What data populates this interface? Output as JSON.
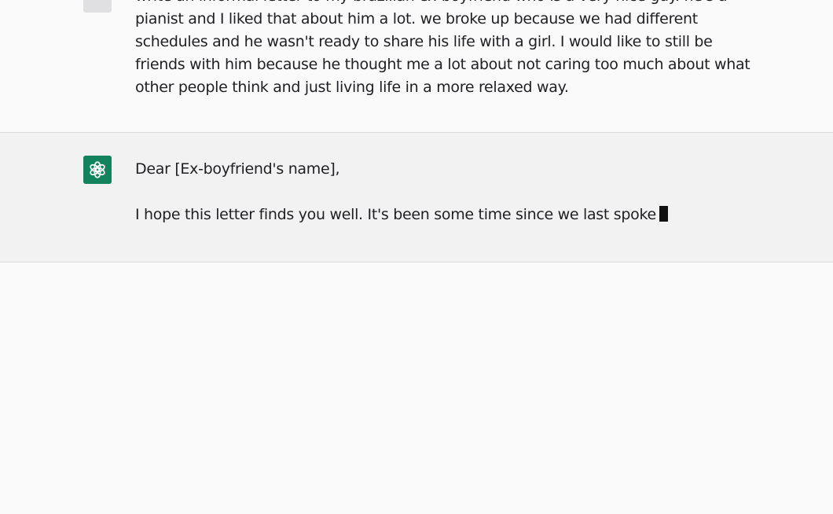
{
  "conversation": {
    "user_message": {
      "text": "write an informal letter to my brazilian ex-boyfriend who is a very nice guy. he's a pianist and I liked that about him a lot. we broke up because we had different schedules and he wasn't ready to share his life with a girl. I would like to still be friends with him because he thought me a lot about not caring too much about what other people think and just living life in a more relaxed way."
    },
    "assistant_message": {
      "paragraphs": [
        "Dear [Ex-boyfriend's name],",
        "I hope this letter finds you well. It's been some time since we last spoke"
      ],
      "avatar_icon": "openai-logo-icon",
      "cursor_icon": "typing-cursor-icon"
    }
  },
  "colors": {
    "assistant_avatar_bg": "#12835d",
    "user_row_bg": "#fafafa",
    "assistant_row_bg": "#f2f2f3",
    "divider": "#d9d9de"
  }
}
